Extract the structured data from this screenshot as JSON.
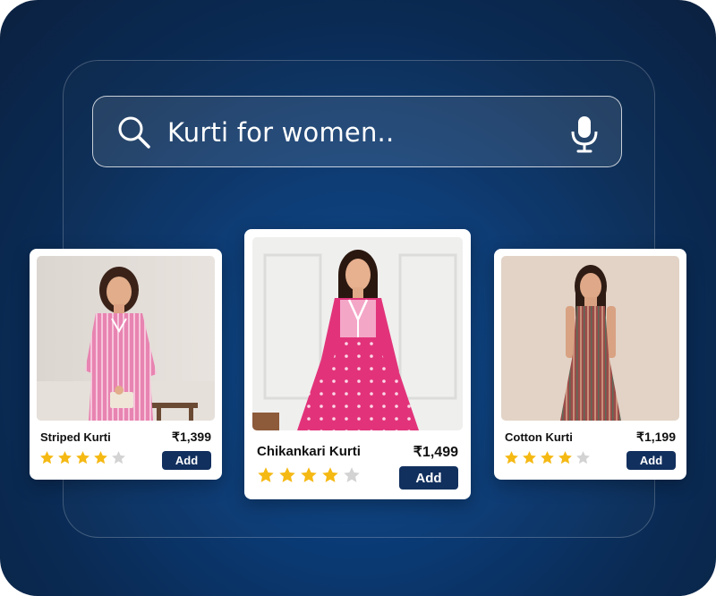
{
  "search": {
    "query": "Kurti for women..",
    "search_icon": "search-icon",
    "mic_icon": "microphone-icon"
  },
  "colors": {
    "accent_button": "#12305e",
    "star_filled": "#f5b914",
    "star_empty": "#d3d3d3",
    "background": "#0a2b55"
  },
  "products": [
    {
      "name": "Striped Kurti",
      "price": "₹1,399",
      "rating": 4,
      "rating_max": 5,
      "add_label": "Add"
    },
    {
      "name": "Chikankari Kurti",
      "price": "₹1,499",
      "rating": 4,
      "rating_max": 5,
      "add_label": "Add"
    },
    {
      "name": "Cotton Kurti",
      "price": "₹1,199",
      "rating": 4,
      "rating_max": 5,
      "add_label": "Add"
    }
  ]
}
